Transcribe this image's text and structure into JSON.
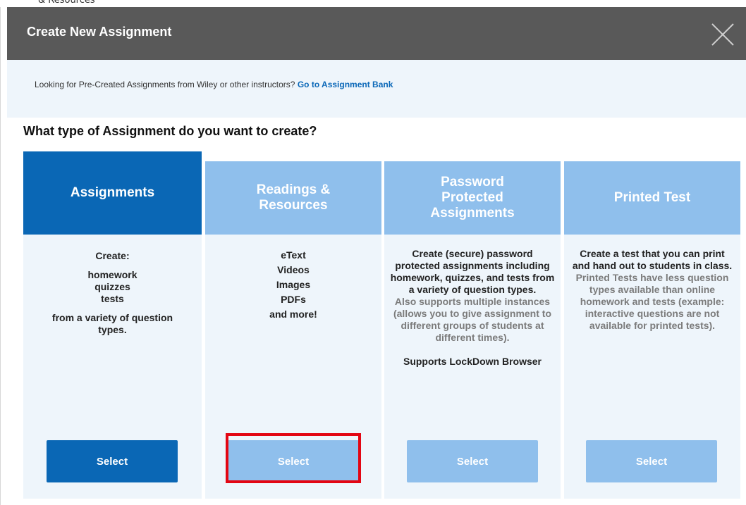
{
  "background": {
    "crumb_text": "& Resources"
  },
  "modal": {
    "title": "Create New Assignment",
    "close_icon": "close-icon",
    "bank_prompt": "Looking for Pre-Created Assignments from Wiley or other instructors?",
    "bank_link": "Go to Assignment Bank",
    "question": "What type of Assignment do you want to create?"
  },
  "cards": [
    {
      "title": "Assignments",
      "lines": [
        "Create:",
        "homework",
        "quizzes",
        "tests",
        "from a variety of question",
        "types."
      ],
      "button": "Select",
      "selected": true
    },
    {
      "title": "Readings & Resources",
      "lines": [
        "eText",
        "Videos",
        "Images",
        "PDFs",
        "and more!"
      ],
      "button": "Select",
      "selected": false
    },
    {
      "title": "Password Protected Assignments",
      "lines": [
        "Create (secure) password protected assignments including homework, quizzes, and tests from a variety of question types.",
        "Also supports multiple instances (allows you to give assignment to different groups of students at different times).",
        "Supports LockDown Browser"
      ],
      "button": "Select",
      "selected": false
    },
    {
      "title": "Printed Test",
      "lines": [
        "Create a test that you can print and hand out to students in class.",
        "Printed Tests have less question types available than online homework and tests (example: interactive questions are not available for printed tests)."
      ],
      "button": "Select",
      "selected": false
    }
  ],
  "colors": {
    "active_blue": "#0a67b5",
    "inactive_blue": "#8fbfec",
    "panel_bg": "#eef5fb",
    "titlebar": "#595959",
    "highlight_red": "#e30613",
    "link_blue": "#0b68b8"
  }
}
